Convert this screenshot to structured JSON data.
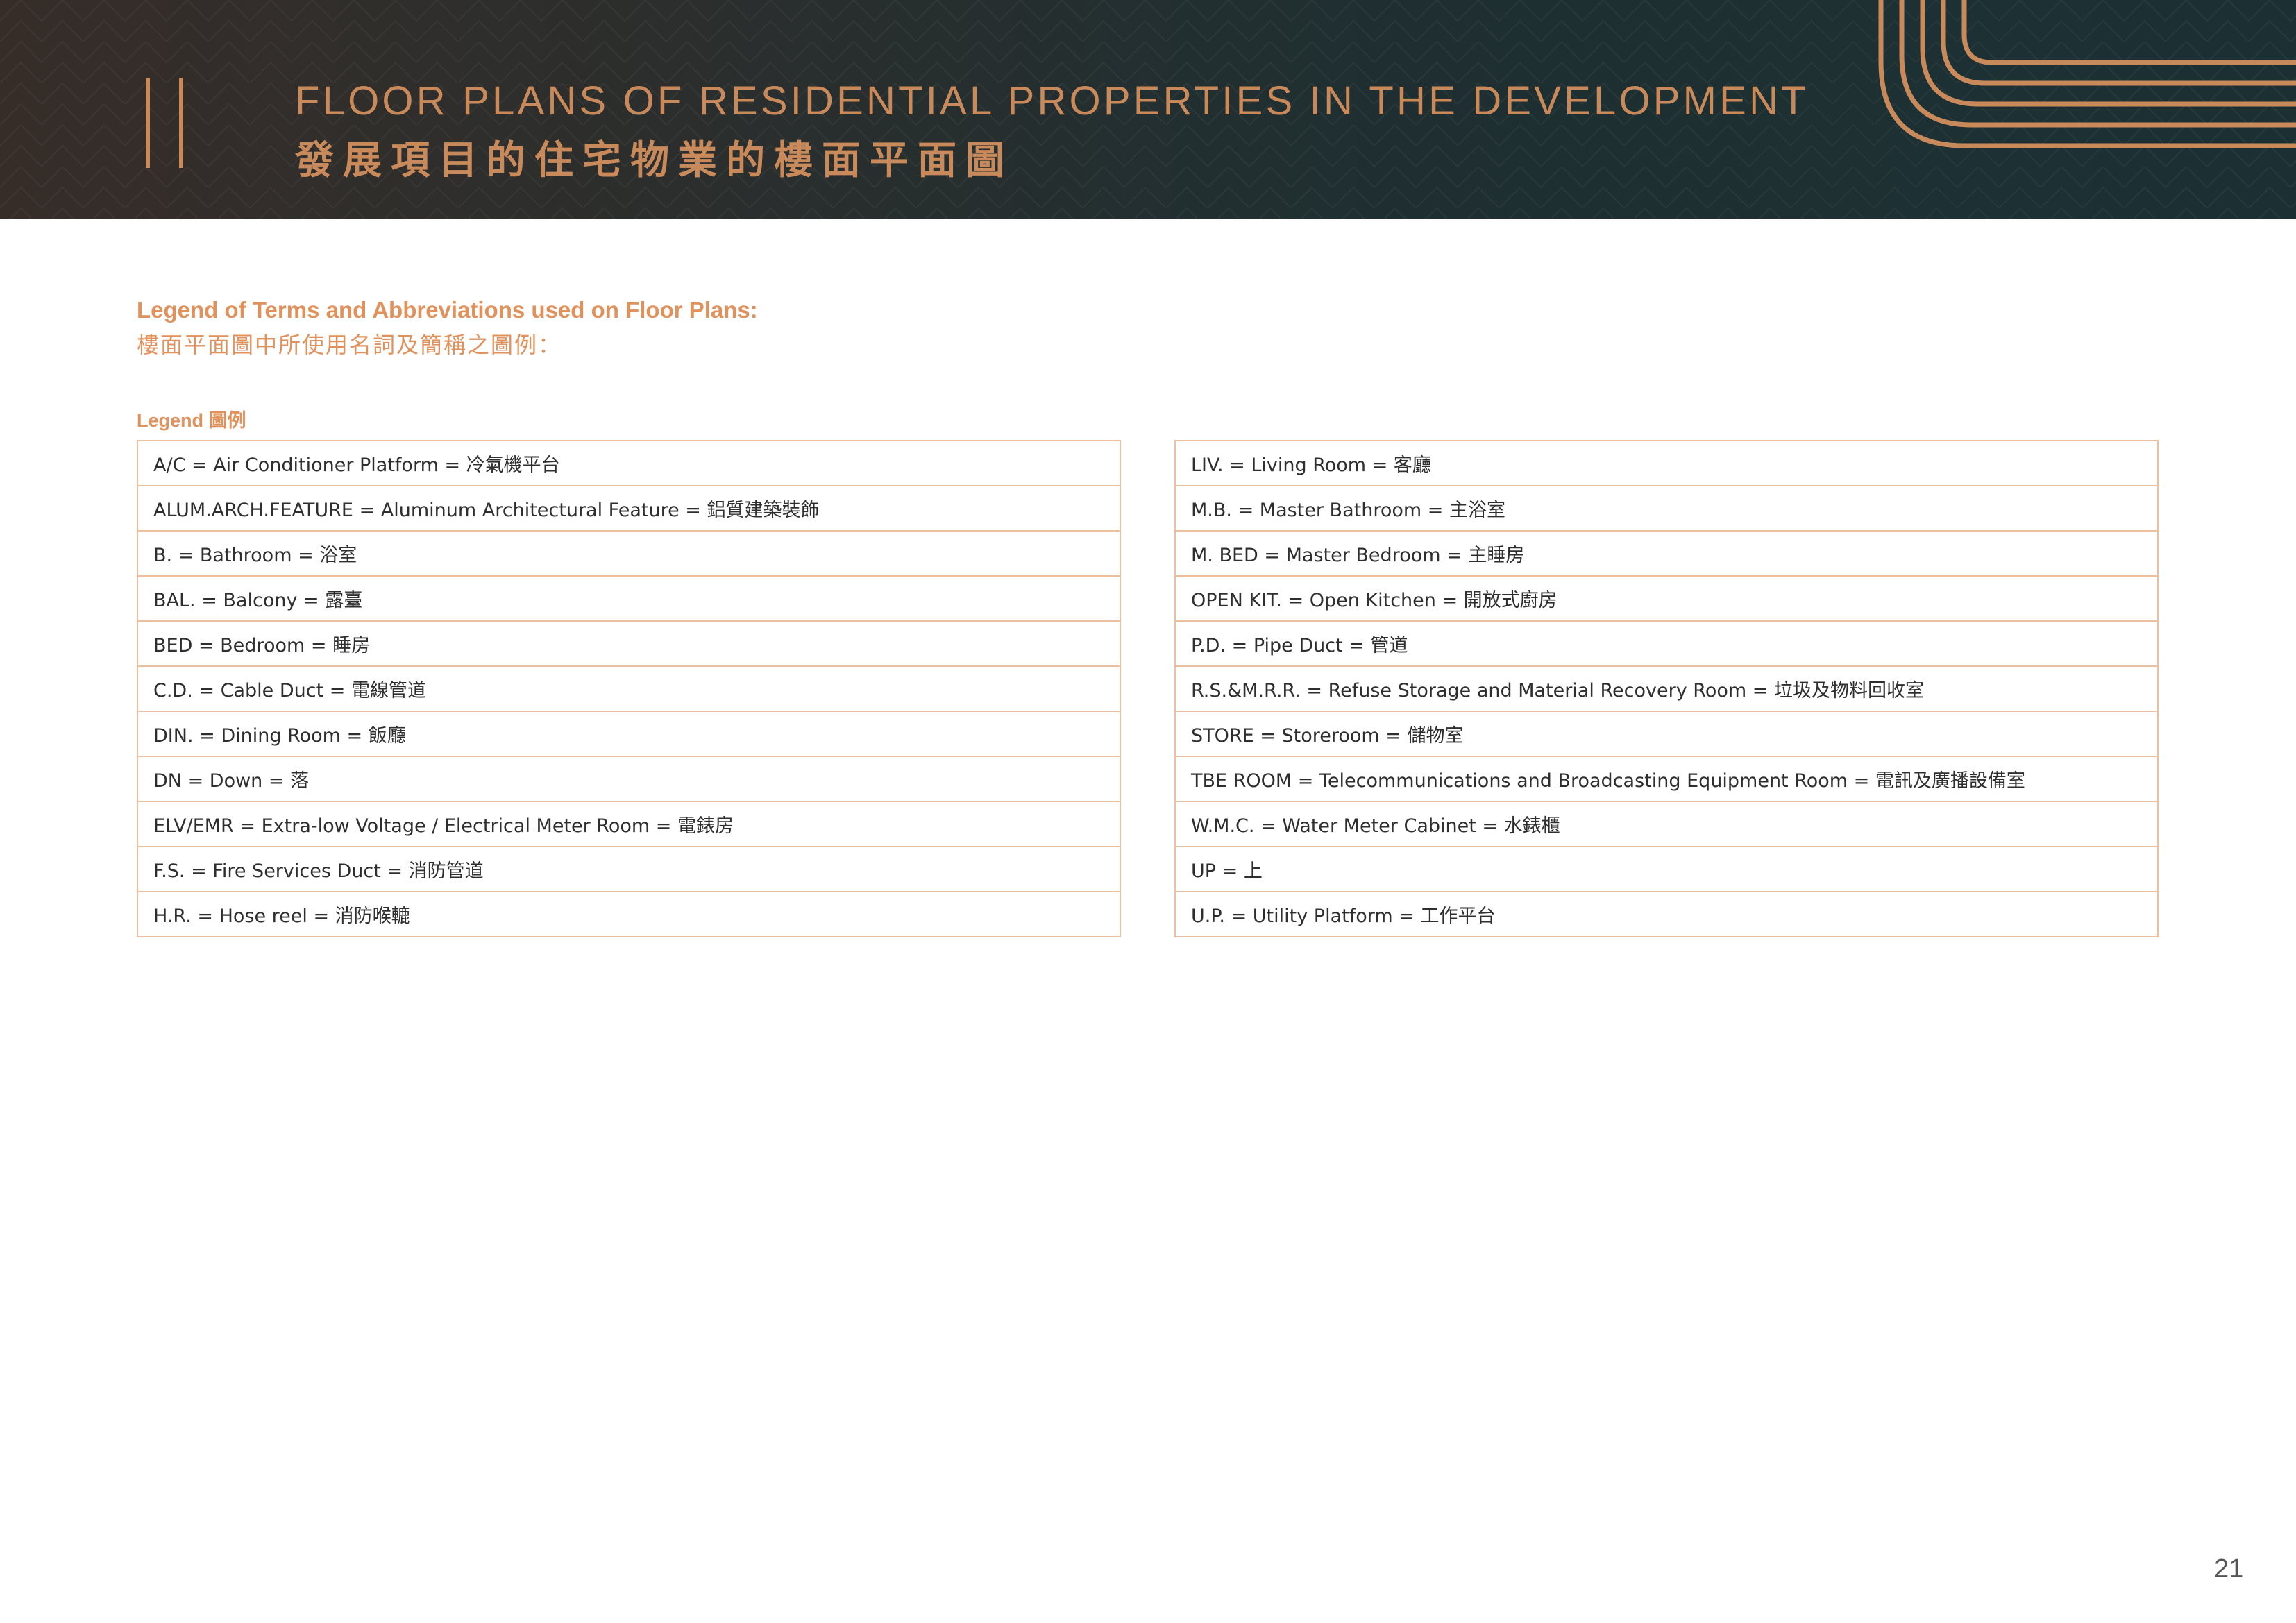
{
  "header": {
    "section_number": "II",
    "title_en": "FLOOR PLANS OF RESIDENTIAL PROPERTIES IN THE DEVELOPMENT",
    "title_zh": "發展項目的住宅物業的樓面平面圖"
  },
  "legend": {
    "heading_en": "Legend of Terms and Abbreviations used on Floor Plans:",
    "heading_zh": "樓面平面圖中所使用名詞及簡稱之圖例：",
    "label": "Legend 圖例",
    "left_items": [
      "A/C = Air Conditioner Platform = 冷氣機平台",
      "ALUM.ARCH.FEATURE = Aluminum Architectural Feature = 鋁質建築裝飾",
      "B. = Bathroom = 浴室",
      "BAL. = Balcony = 露臺",
      "BED = Bedroom = 睡房",
      "C.D. = Cable Duct = 電線管道",
      "DIN. = Dining Room = 飯廳",
      "DN = Down = 落",
      "ELV/EMR = Extra-low Voltage / Electrical Meter Room = 電錶房",
      "F.S. = Fire Services Duct = 消防管道",
      "H.R. = Hose reel = 消防喉轆"
    ],
    "right_items": [
      "LIV. = Living Room = 客廳",
      "M.B. = Master Bathroom = 主浴室",
      "M. BED = Master Bedroom = 主睡房",
      "OPEN KIT. = Open Kitchen = 開放式廚房",
      "P.D. = Pipe Duct = 管道",
      "R.S.&M.R.R. = Refuse Storage and Material Recovery Room = 垃圾及物料回收室",
      "STORE = Storeroom = 儲物室",
      "TBE ROOM = Telecommunications and Broadcasting Equipment Room = 電訊及廣播設備室",
      "W.M.C. = Water Meter Cabinet = 水錶櫃",
      "UP = 上",
      "U.P. = Utility Platform = 工作平台"
    ]
  },
  "page_number": "21",
  "colors": {
    "accent": "#c98a5b",
    "heading": "#e0915c",
    "table_border": "#ecc09e",
    "header_bg": "#1f2f31"
  }
}
